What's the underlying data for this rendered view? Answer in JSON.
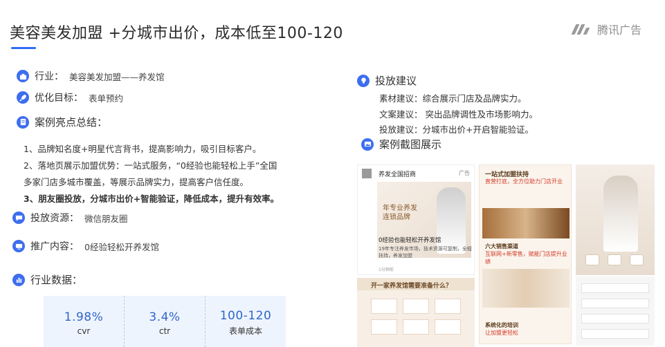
{
  "header": {
    "title": "美容美发加盟 +分城市出价，成本低至100-120",
    "brand": "腾讯广告"
  },
  "left": {
    "industry": {
      "label": "行业：",
      "value": "美容美发加盟——养发馆",
      "icon": "briefcase-icon"
    },
    "goal": {
      "label": "优化目标：",
      "value": "表单预约",
      "icon": "rocket-icon"
    },
    "highlights_title": {
      "label": "案例亮点总结：",
      "icon": "document-icon"
    },
    "highlights": [
      "1、品牌知名度+明星代言背书，提高影响力，吸引目标客户。",
      "2、落地页展示加盟优势：一站式服务，“0经验也能轻松上手”全国",
      "多家门店多城市覆盖，等展示品牌实力，提高客户信任度。",
      "3、朋友圈投放，分城市出价+智能验证，降低成本，提升有效率。"
    ],
    "resource": {
      "label": "投放资源：",
      "value": "微信朋友圈",
      "icon": "chat-icon"
    },
    "content": {
      "label": "推广内容：",
      "value": "0经验轻松开养发馆",
      "icon": "monitor-icon"
    },
    "data_title": {
      "label": "行业数据：",
      "icon": "bar-chart-icon"
    },
    "stats": [
      {
        "value": "1.98%",
        "label": "cvr"
      },
      {
        "value": "3.4%",
        "label": "ctr"
      },
      {
        "value": "100-120",
        "label": "表单成本"
      }
    ]
  },
  "right": {
    "advice_title": {
      "label": "投放建议",
      "icon": "lightbulb-icon"
    },
    "advice": [
      "素材建议：综合展示门店及品牌实力。",
      "文案建议：  突出品牌调性及市场影响力。",
      "投放建议：分城市出价+开启智能验证。"
    ],
    "screenshots_title": {
      "label": "案例截图展示",
      "icon": "image-icon"
    },
    "shot_a": {
      "account": "养发全国招商",
      "ad": "广告",
      "poster_line1": "年专业养发",
      "poster_line2": "连锁品牌",
      "caption": "0经验也能轻松开养发馆",
      "caption2": "19年专注养发市场，技术资源可复制，全程扶持，养发加盟",
      "foot": "1分钟前"
    },
    "shot_b": {
      "heading": "开一家养发馆需要准备什么？"
    },
    "shot_c": {
      "h1": "一站式加盟扶持",
      "h2": "直营打底，全方位助力门店开业",
      "h3": "六大销售渠道",
      "h4": "互联网+新零售，赋能门店提升业绩",
      "h5": "系统化的培训",
      "h6": "让加盟更轻松"
    }
  }
}
